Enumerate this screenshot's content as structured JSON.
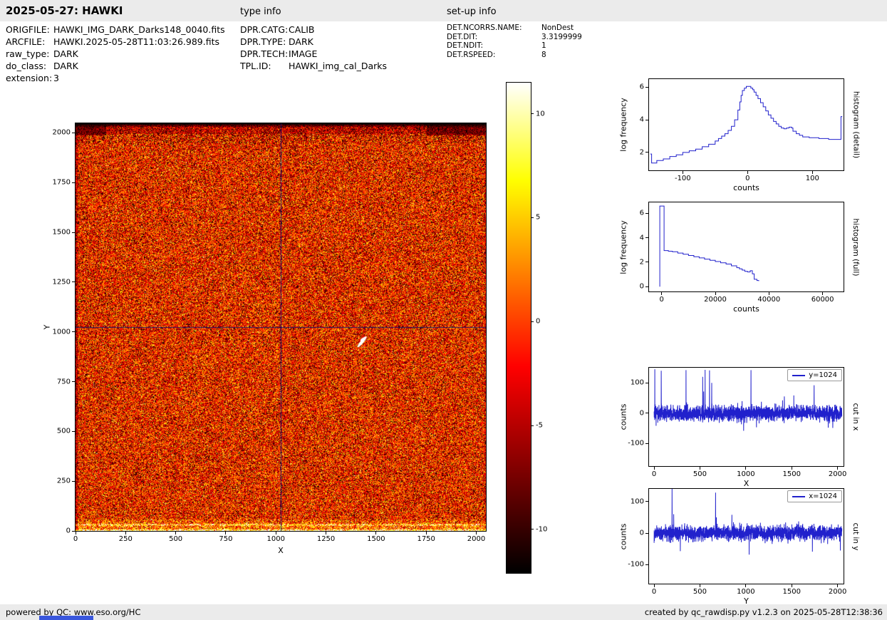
{
  "page": {
    "title": "2025-05-27: HAWKI",
    "section_type_info": "type info",
    "section_setup_info": "set-up info",
    "footer_left": "powered by QC: www.eso.org/HC",
    "footer_right": "created by qc_rawdisp.py v1.2.3 on 2025-05-28T12:38:36"
  },
  "metadata": {
    "left": [
      {
        "label": "ORIGFILE:",
        "value": "HAWKI_IMG_DARK_Darks148_0040.fits"
      },
      {
        "label": "ARCFILE:",
        "value": "HAWKI.2025-05-28T11:03:26.989.fits"
      },
      {
        "label": "raw_type:",
        "value": "DARK"
      },
      {
        "label": "do_class:",
        "value": "DARK"
      },
      {
        "label": "extension:",
        "value": "3"
      }
    ],
    "middle": [
      {
        "label": "DPR.CATG:",
        "value": "CALIB"
      },
      {
        "label": "DPR.TYPE:",
        "value": "DARK"
      },
      {
        "label": "DPR.TECH:",
        "value": "IMAGE"
      },
      {
        "label": "TPL.ID:",
        "value": "HAWKI_img_cal_Darks"
      }
    ],
    "right": [
      {
        "label": "DET.NCORRS.NAME:",
        "value": "NonDest"
      },
      {
        "label": "DET.DIT:",
        "value": "3.3199999"
      },
      {
        "label": "DET.NDIT:",
        "value": "1"
      },
      {
        "label": "DET.RSPEED:",
        "value": "8"
      }
    ]
  },
  "chart_data": [
    {
      "id": "main-image",
      "type": "heatmap",
      "xlabel": "X",
      "ylabel": "Y",
      "xlim": [
        0,
        2048
      ],
      "ylim": [
        0,
        2048
      ],
      "xticks": [
        0,
        250,
        500,
        750,
        1000,
        1250,
        1500,
        1750,
        2000
      ],
      "yticks": [
        0,
        250,
        500,
        750,
        1000,
        1250,
        1500,
        1750,
        2000
      ],
      "colormap": "hot",
      "noise": {
        "seed": 42,
        "base": 0.18,
        "spread": 0.55,
        "dark_fraction": 0.1,
        "bright_fraction": 0.06
      },
      "features": {
        "crosshair_x": 1024,
        "crosshair_y": 1024,
        "crosshair_color": "#0f0f6e",
        "bright_bottom_band": true,
        "dark_top_band": true,
        "white_streak": {
          "x": 1430,
          "y": 950,
          "length": 70,
          "width": 16,
          "angle_deg": -50
        }
      },
      "colorbar": {
        "vmin": -12.1,
        "vmax": 11.5,
        "ticks": [
          10,
          5,
          0,
          -5,
          -10
        ]
      }
    },
    {
      "id": "histogram-detail",
      "type": "line",
      "step": true,
      "xlabel": "counts",
      "ylabel": "log frequency",
      "right_label": "histogram (detail)",
      "line_color": "#2121cc",
      "xlim": [
        -152,
        148
      ],
      "ylim": [
        0.9,
        6.5
      ],
      "xticks": [
        -100,
        0,
        100
      ],
      "yticks": [
        2,
        4,
        6
      ],
      "points": [
        [
          -150,
          1.9
        ],
        [
          -148,
          1.35
        ],
        [
          -140,
          1.5
        ],
        [
          -130,
          1.6
        ],
        [
          -120,
          1.75
        ],
        [
          -110,
          1.85
        ],
        [
          -100,
          2.0
        ],
        [
          -90,
          2.1
        ],
        [
          -80,
          2.2
        ],
        [
          -70,
          2.35
        ],
        [
          -60,
          2.5
        ],
        [
          -50,
          2.7
        ],
        [
          -45,
          2.85
        ],
        [
          -40,
          3.0
        ],
        [
          -35,
          3.15
        ],
        [
          -30,
          3.35
        ],
        [
          -25,
          3.6
        ],
        [
          -20,
          4.0
        ],
        [
          -15,
          4.6
        ],
        [
          -12,
          5.1
        ],
        [
          -10,
          5.5
        ],
        [
          -8,
          5.8
        ],
        [
          -5,
          5.95
        ],
        [
          -2,
          6.05
        ],
        [
          2,
          6.05
        ],
        [
          5,
          5.95
        ],
        [
          8,
          5.85
        ],
        [
          10,
          5.7
        ],
        [
          13,
          5.5
        ],
        [
          16,
          5.3
        ],
        [
          20,
          5.05
        ],
        [
          24,
          4.8
        ],
        [
          28,
          4.55
        ],
        [
          32,
          4.3
        ],
        [
          36,
          4.1
        ],
        [
          40,
          3.9
        ],
        [
          44,
          3.75
        ],
        [
          48,
          3.6
        ],
        [
          52,
          3.5
        ],
        [
          56,
          3.45
        ],
        [
          60,
          3.5
        ],
        [
          64,
          3.55
        ],
        [
          68,
          3.5
        ],
        [
          70,
          3.3
        ],
        [
          75,
          3.15
        ],
        [
          80,
          3.05
        ],
        [
          85,
          2.95
        ],
        [
          95,
          2.9
        ],
        [
          110,
          2.85
        ],
        [
          125,
          2.8
        ],
        [
          140,
          2.8
        ],
        [
          144,
          2.8
        ],
        [
          144,
          4.2
        ],
        [
          146,
          4.2
        ]
      ]
    },
    {
      "id": "histogram-full",
      "type": "line",
      "step": true,
      "xlabel": "counts",
      "ylabel": "log frequency",
      "right_label": "histogram (full)",
      "line_color": "#2121cc",
      "xlim": [
        -4700,
        67800
      ],
      "ylim": [
        -0.4,
        6.9
      ],
      "xticks": [
        0,
        20000,
        40000,
        60000
      ],
      "yticks": [
        0,
        2,
        4,
        6
      ],
      "points": [
        [
          -700,
          0
        ],
        [
          -700,
          6.6
        ],
        [
          500,
          6.6
        ],
        [
          900,
          2.95
        ],
        [
          2500,
          2.9
        ],
        [
          4000,
          2.85
        ],
        [
          6000,
          2.75
        ],
        [
          8000,
          2.65
        ],
        [
          10000,
          2.55
        ],
        [
          12000,
          2.45
        ],
        [
          14000,
          2.35
        ],
        [
          16000,
          2.25
        ],
        [
          18000,
          2.15
        ],
        [
          20000,
          2.05
        ],
        [
          22000,
          1.95
        ],
        [
          24000,
          1.85
        ],
        [
          26000,
          1.7
        ],
        [
          28000,
          1.55
        ],
        [
          29000,
          1.45
        ],
        [
          30000,
          1.35
        ],
        [
          31000,
          1.25
        ],
        [
          32000,
          1.2
        ],
        [
          33000,
          1.3
        ],
        [
          33800,
          1.05
        ],
        [
          34500,
          0.6
        ],
        [
          35500,
          0.5
        ],
        [
          36200,
          0.45
        ]
      ]
    },
    {
      "id": "cut-x",
      "type": "line",
      "xlabel": "X",
      "ylabel": "counts",
      "right_label": "cut in x",
      "legend": "y=1024",
      "line_color": "#2121cc",
      "xlim": [
        -55,
        2065
      ],
      "ylim": [
        -175,
        150
      ],
      "xticks": [
        0,
        500,
        1000,
        1500,
        2000
      ],
      "yticks": [
        -100,
        0,
        100
      ],
      "noise": {
        "seed": 7,
        "n": 2048,
        "std": 13
      },
      "spikes": [
        [
          8,
          145
        ],
        [
          78,
          140
        ],
        [
          348,
          142
        ],
        [
          530,
          120
        ],
        [
          556,
          143
        ],
        [
          604,
          141
        ],
        [
          628,
          100
        ],
        [
          1056,
          142
        ],
        [
          1420,
          55
        ],
        [
          1744,
          92
        ],
        [
          1898,
          -48
        ]
      ]
    },
    {
      "id": "cut-y",
      "type": "line",
      "xlabel": "Y",
      "ylabel": "counts",
      "right_label": "cut in y",
      "legend": "x=1024",
      "line_color": "#2121cc",
      "xlim": [
        -55,
        2065
      ],
      "ylim": [
        -160,
        140
      ],
      "xticks": [
        0,
        500,
        1000,
        1500,
        2000
      ],
      "yticks": [
        -100,
        0,
        100
      ],
      "noise": {
        "seed": 13,
        "n": 2048,
        "std": 12
      },
      "spikes": [
        [
          196,
          143
        ],
        [
          214,
          60
        ],
        [
          670,
          128
        ],
        [
          848,
          58
        ],
        [
          1036,
          -68
        ],
        [
          2030,
          -55
        ]
      ]
    }
  ]
}
